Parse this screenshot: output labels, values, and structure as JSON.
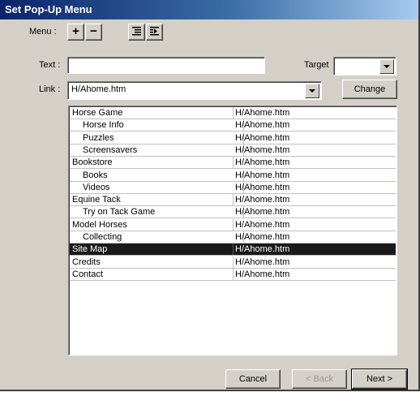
{
  "window": {
    "title": "Set Pop-Up Menu"
  },
  "menu": {
    "label": "Menu :",
    "add": "+",
    "remove": "−"
  },
  "text_field": {
    "label": "Text :",
    "value": ""
  },
  "target": {
    "label": "Target",
    "value": ""
  },
  "link": {
    "label": "Link :",
    "value": "H/Ahome.htm"
  },
  "change_label": "Change",
  "items": [
    {
      "text": "Horse Game",
      "link": "H/Ahome.htm",
      "level": 0
    },
    {
      "text": "Horse Info",
      "link": "H/Ahome.htm",
      "level": 1
    },
    {
      "text": "Puzzles",
      "link": "H/Ahome.htm",
      "level": 1
    },
    {
      "text": "Screensavers",
      "link": "H/Ahome.htm",
      "level": 1
    },
    {
      "text": "Bookstore",
      "link": "H/Ahome.htm",
      "level": 0
    },
    {
      "text": "Books",
      "link": "H/Ahome.htm",
      "level": 1
    },
    {
      "text": "Videos",
      "link": "H/Ahome.htm",
      "level": 1
    },
    {
      "text": "Equine Tack",
      "link": "H/Ahome.htm",
      "level": 0
    },
    {
      "text": "Try on Tack Game",
      "link": "H/Ahome.htm",
      "level": 1
    },
    {
      "text": "Model Horses",
      "link": "H/Ahome.htm",
      "level": 0
    },
    {
      "text": "Collecting",
      "link": "H/Ahome.htm",
      "level": 1
    },
    {
      "text": "Site Map",
      "link": "H/Ahome.htm",
      "level": 0,
      "selected": true
    },
    {
      "text": "Credits",
      "link": "H/Ahome.htm",
      "level": 0
    },
    {
      "text": "Contact",
      "link": "H/Ahome.htm",
      "level": 0
    }
  ],
  "buttons": {
    "cancel": "Cancel",
    "back": "< Back",
    "next": "Next >"
  }
}
